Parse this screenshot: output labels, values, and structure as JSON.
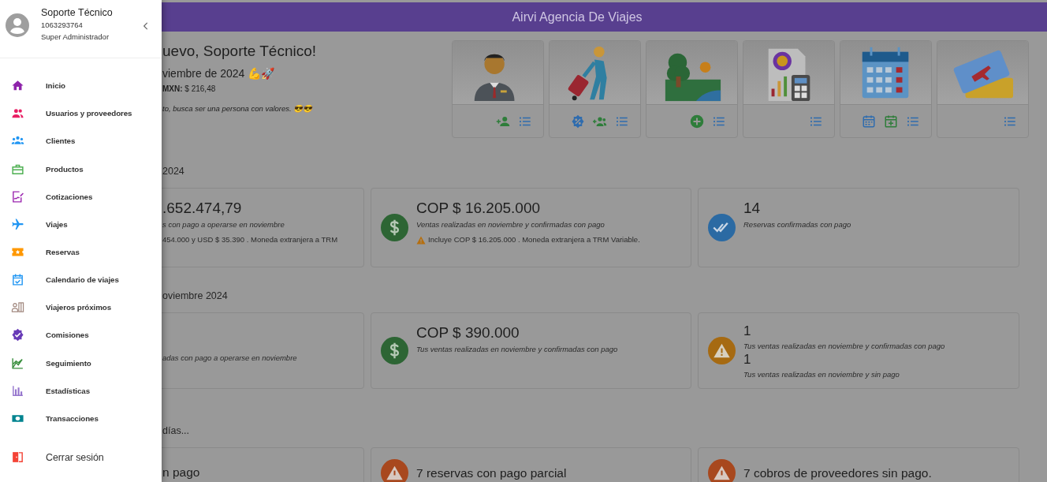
{
  "app_bar": {
    "title": "Airvi Agencia De Viajes"
  },
  "greeting": {
    "title": "uevo, Soporte Técnico!",
    "date": "viembre de 2024 💪🚀",
    "rate": "**MXN:** $ 216,48",
    "motto": "to, busca ser una persona con valores. 😎😎"
  },
  "sections": [
    {
      "heading": "2024",
      "cards": [
        {
          "kind": "none",
          "lines": [
            {
              "kind": "value",
              "text": ".652.474,79"
            },
            {
              "kind": "caption",
              "text": "s con pago a operarse en noviembre"
            },
            {
              "kind": "note",
              "text": "454.000 y USD $ 35.390 . Moneda extranjera a TRM"
            }
          ]
        },
        {
          "kind": "money",
          "lines": [
            {
              "kind": "value",
              "text": "COP $ 16.205.000"
            },
            {
              "kind": "caption",
              "text": "Ventas realizadas en noviembre y confirmadas con pago"
            },
            {
              "kind": "warning-note",
              "text": "Incluye COP $ 16.205.000 . Moneda extranjera a TRM Variable."
            }
          ]
        },
        {
          "kind": "check",
          "lines": [
            {
              "kind": "value",
              "text": "14"
            },
            {
              "kind": "caption",
              "text": "Reservas confirmadas con pago"
            }
          ]
        }
      ]
    },
    {
      "heading": "oviembre 2024",
      "cards": [
        {
          "kind": "none",
          "lines": [
            {
              "kind": "caption",
              "text": "adas con pago a operarse en noviembre"
            }
          ]
        },
        {
          "kind": "money",
          "lines": [
            {
              "kind": "value",
              "text": "COP $ 390.000"
            },
            {
              "kind": "caption",
              "text": "Tus ventas realizadas en noviembre y confirmadas con pago"
            }
          ]
        },
        {
          "kind": "warning",
          "lines": [
            {
              "kind": "count",
              "text": "1"
            },
            {
              "kind": "caption",
              "text": "Tus ventas realizadas en noviembre y confirmadas con pago"
            },
            {
              "kind": "count",
              "text": "1"
            },
            {
              "kind": "caption",
              "text": "Tus ventas realizadas en noviembre y sin pago"
            }
          ]
        }
      ]
    },
    {
      "heading": "días...",
      "cards": [
        {
          "kind": "none",
          "lines": [
            {
              "kind": "title",
              "text": "n pago"
            }
          ]
        },
        {
          "kind": "alert",
          "lines": [
            {
              "kind": "title",
              "text": "7 reservas con pago parcial"
            }
          ]
        },
        {
          "kind": "alert",
          "lines": [
            {
              "kind": "title",
              "text": "7 cobros de proveedores sin pago."
            }
          ]
        }
      ]
    }
  ],
  "drawer": {
    "user": {
      "name": "Soporte Técnico",
      "id": "1063293764",
      "role": "Super Administrador"
    },
    "menu": [
      {
        "label": "Inicio"
      },
      {
        "label": "Usuarios y proveedores"
      },
      {
        "label": "Clientes"
      },
      {
        "label": "Productos"
      },
      {
        "label": "Cotizaciones"
      },
      {
        "label": "Viajes"
      },
      {
        "label": "Reservas"
      },
      {
        "label": "Calendario de viajes"
      },
      {
        "label": "Viajeros próximos"
      },
      {
        "label": "Comisiones"
      },
      {
        "label": "Seguimiento"
      },
      {
        "label": "Estadísticas"
      },
      {
        "label": "Transacciones"
      }
    ],
    "logout": {
      "label": "Cerrar sesión"
    }
  }
}
